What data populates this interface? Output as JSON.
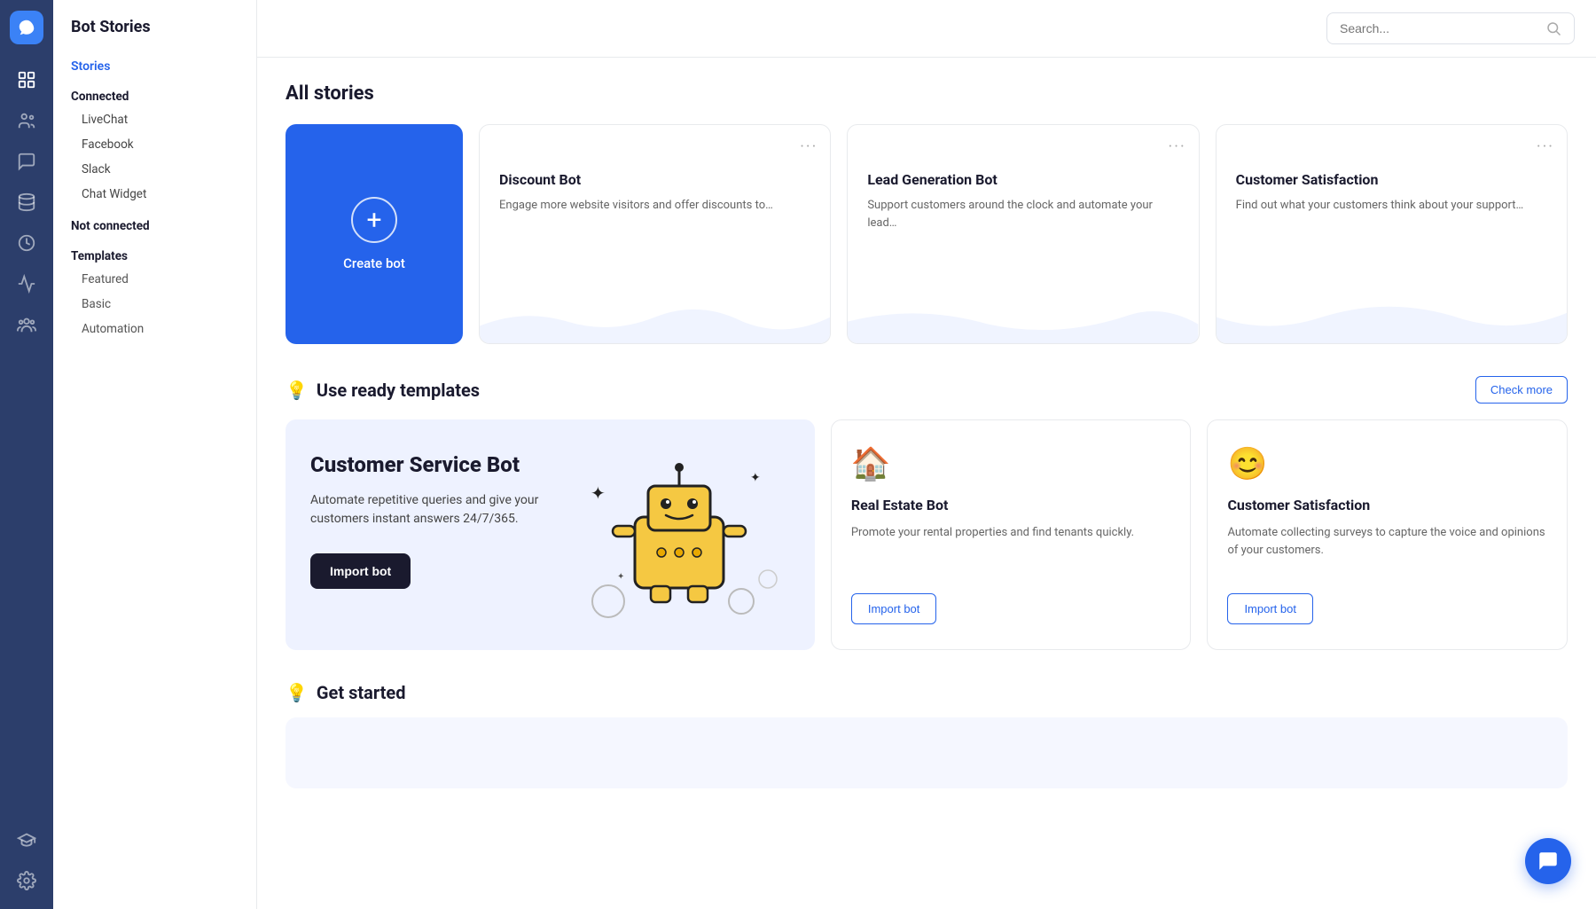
{
  "app": {
    "title": "Bot Stories"
  },
  "sidebar": {
    "title": "Bot Stories",
    "stories_label": "Stories",
    "connected_label": "Connected",
    "connected_items": [
      "LiveChat",
      "Facebook",
      "Slack",
      "Chat Widget"
    ],
    "not_connected_label": "Not connected",
    "templates_label": "Templates",
    "template_items": [
      "Featured",
      "Basic",
      "Automation"
    ]
  },
  "search": {
    "placeholder": "Search..."
  },
  "main": {
    "all_stories_title": "All stories",
    "create_bot_label": "Create bot",
    "bot_cards": [
      {
        "title": "Discount Bot",
        "description": "Engage more website visitors and offer discounts to…"
      },
      {
        "title": "Lead Generation Bot",
        "description": "Support customers around the clock and automate your lead…"
      },
      {
        "title": "Customer Satisfaction",
        "description": "Find out what your customers think about your support…"
      }
    ],
    "templates_section_title": "Use ready templates",
    "check_more_label": "Check more",
    "featured_template": {
      "title": "Customer Service Bot",
      "description": "Automate repetitive queries and give your customers instant answers 24/7/365.",
      "import_label": "Import bot"
    },
    "small_templates": [
      {
        "icon": "🏠",
        "title": "Real Estate Bot",
        "description": "Promote your rental properties and find tenants quickly.",
        "import_label": "Import bot"
      },
      {
        "icon": "😊",
        "title": "Customer Satisfaction",
        "description": "Automate collecting surveys to capture the voice and opinions of your customers.",
        "import_label": "Import bot"
      }
    ],
    "get_started_title": "Get started"
  },
  "icons": {
    "dashboard": "⊞",
    "users": "👥",
    "chat": "💬",
    "database": "🗄",
    "clock": "⏱",
    "chart": "📈",
    "people": "👤",
    "graduation": "🎓",
    "settings": "⚙"
  }
}
